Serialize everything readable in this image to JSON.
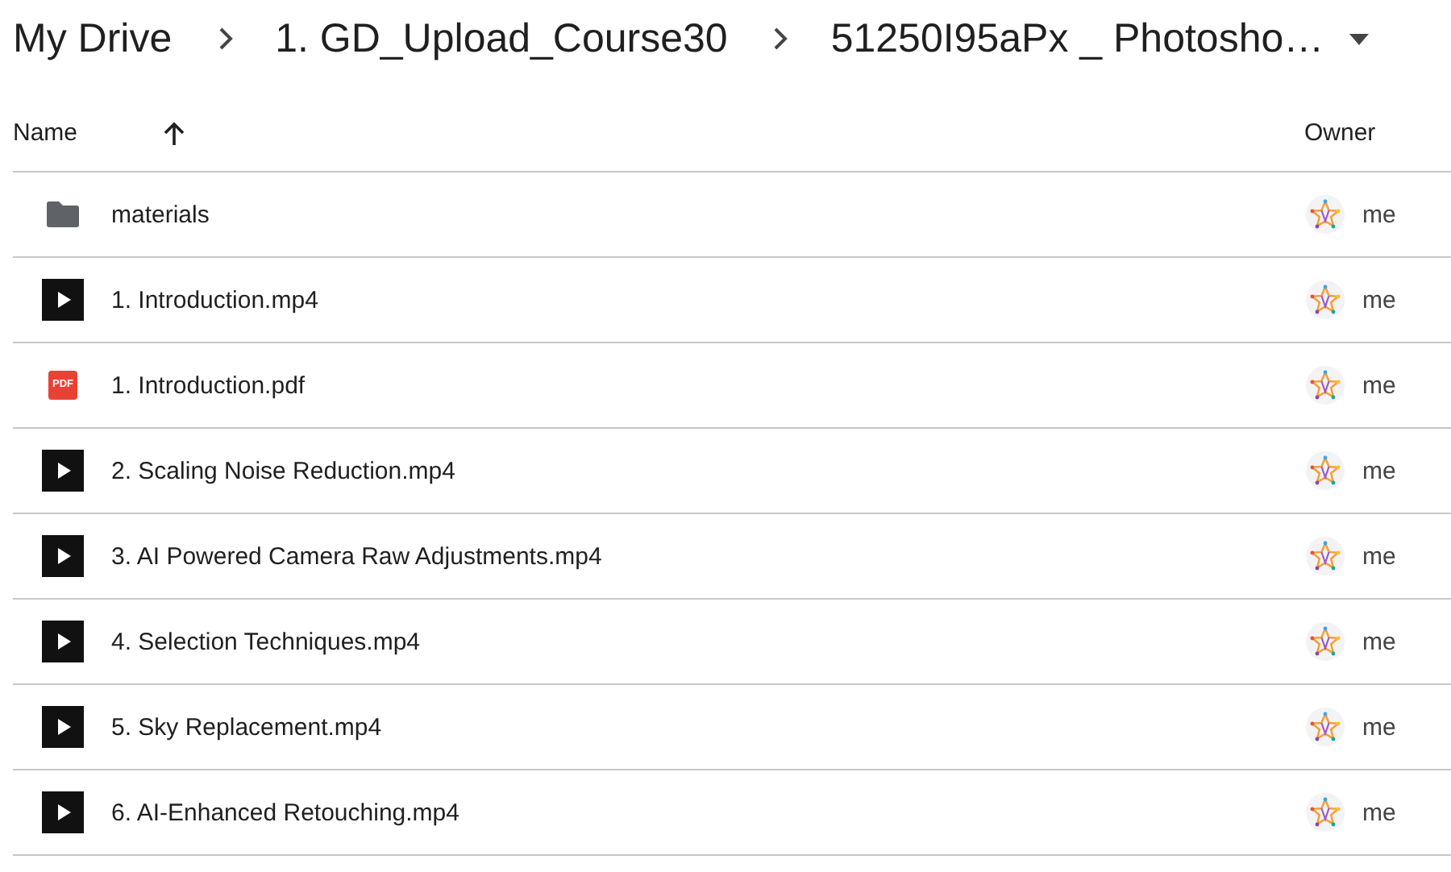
{
  "breadcrumbs": [
    {
      "label": "My Drive"
    },
    {
      "label": "1. GD_Upload_Course30"
    },
    {
      "label": "51250I95aPx _ Photosho…"
    }
  ],
  "columns": [
    {
      "label": "Name",
      "sorted": true
    },
    {
      "label": "Owner",
      "sorted": false
    }
  ],
  "files": [
    {
      "kind": "folder",
      "name": "materials",
      "owner": "me"
    },
    {
      "kind": "video",
      "name": "1. Introduction.mp4",
      "owner": "me"
    },
    {
      "kind": "pdf",
      "badge": "PDF",
      "name": "1. Introduction.pdf",
      "owner": "me"
    },
    {
      "kind": "video",
      "name": "2. Scaling Noise Reduction.mp4",
      "owner": "me"
    },
    {
      "kind": "video",
      "name": "3. AI Powered Camera Raw Adjustments.mp4",
      "owner": "me"
    },
    {
      "kind": "video",
      "name": "4. Selection Techniques.mp4",
      "owner": "me"
    },
    {
      "kind": "video",
      "name": "5. Sky Replacement.mp4",
      "owner": "me"
    },
    {
      "kind": "video",
      "name": "6. AI-Enhanced Retouching.mp4",
      "owner": "me"
    }
  ]
}
